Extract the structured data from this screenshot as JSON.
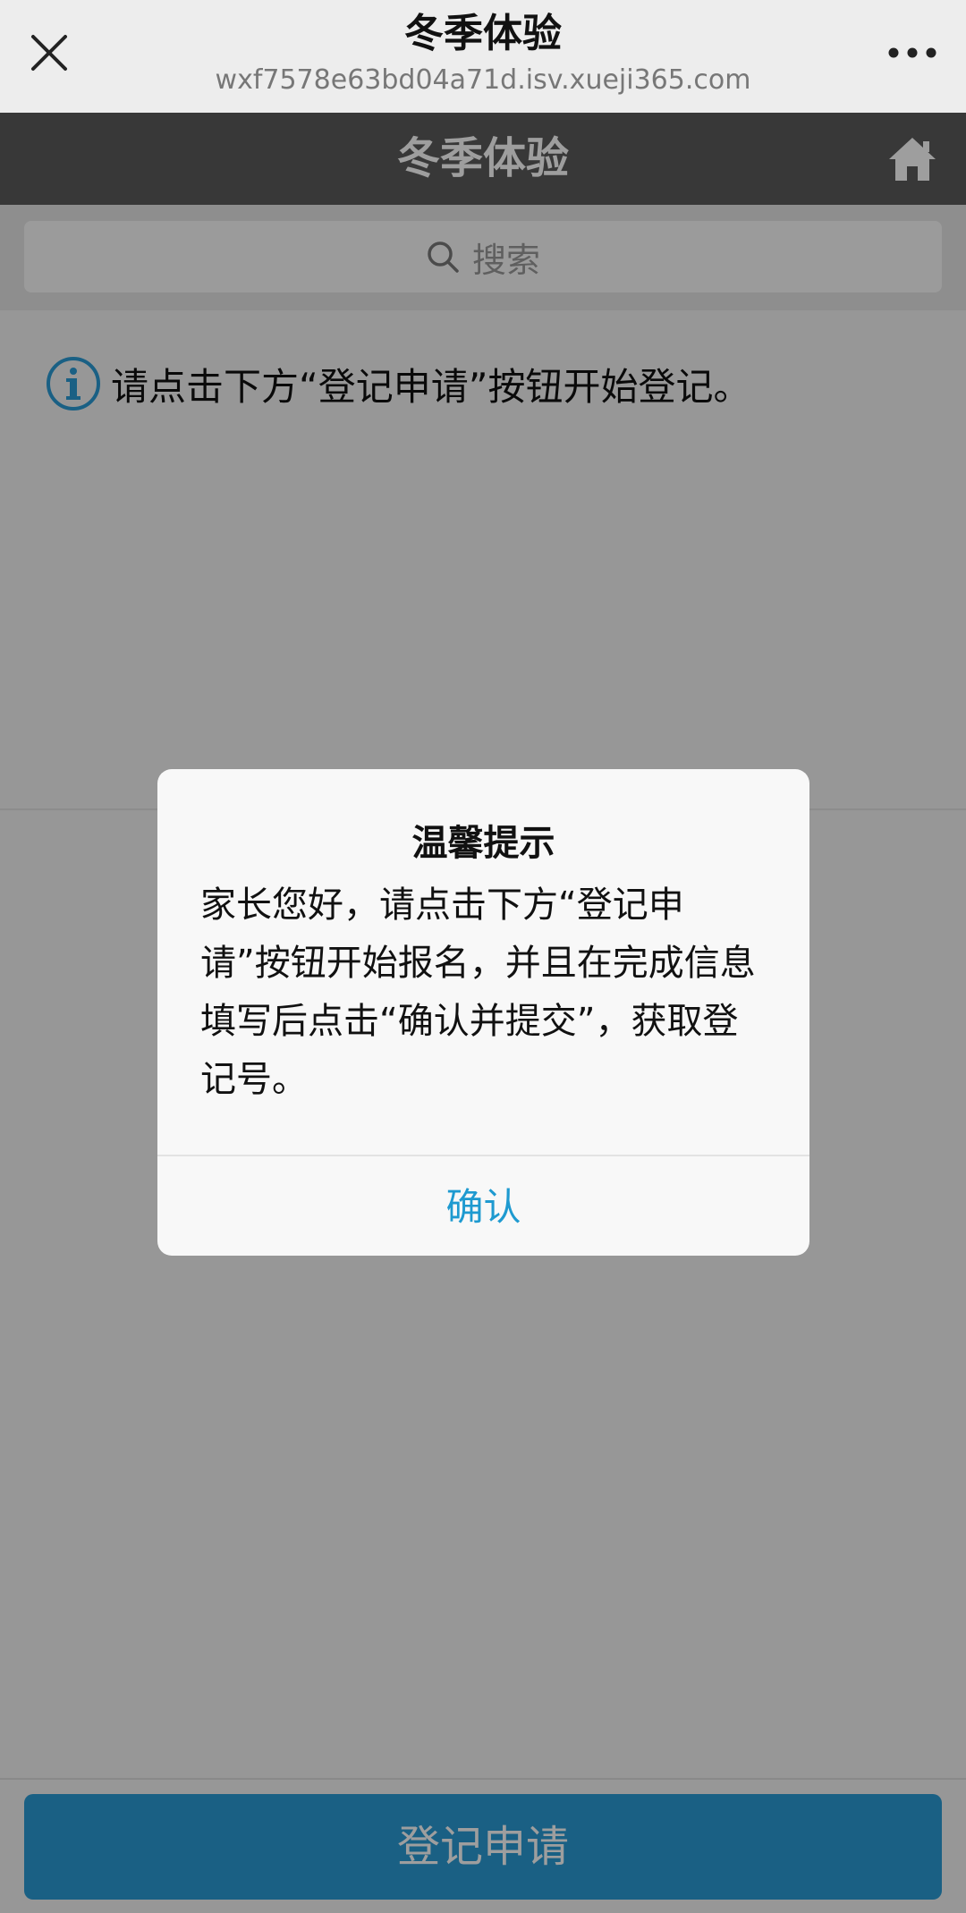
{
  "wechat_bar": {
    "title": "冬季体验",
    "url": "wxf7578e63bd04a71d.isv.xueji365.com"
  },
  "header": {
    "title": "冬季体验"
  },
  "search": {
    "placeholder": "搜索"
  },
  "info": {
    "text": "请点击下方“登记申请”按钮开始登记。"
  },
  "register_button": {
    "label": "登记申请"
  },
  "dialog": {
    "title": "温馨提示",
    "body": "家长您好，请点击下方“登记申请”按钮开始报名，并且在完成信息填写后点击“确认并提交”，获取登记号。",
    "confirm_label": "确认"
  },
  "colors": {
    "header_bg": "#5b5b5b",
    "primary_button": "#2a9bd6",
    "dialog_link": "#1e9ad0",
    "info_icon": "#2a9bd6"
  }
}
